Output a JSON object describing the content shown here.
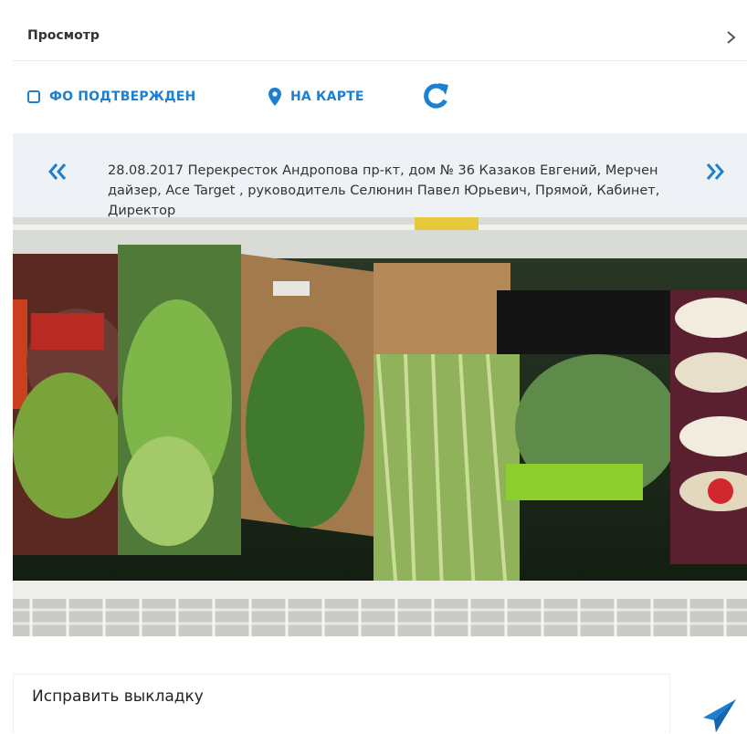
{
  "header": {
    "title": "Просмотр",
    "chevron_icon": "chevron-right-icon"
  },
  "toolbar": {
    "confirmed_label": "ФО ПОДТВЕРЖДЕН",
    "confirmed_checked": false,
    "map_label": "НА КАРТЕ",
    "map_icon": "map-pin-icon",
    "refresh_icon": "refresh-icon"
  },
  "record": {
    "prev_icon": "double-chevron-left-icon",
    "next_icon": "double-chevron-right-icon",
    "description": "28.08.2017 Перекресток Андропова пр-кт, дом № 36 Казаков Евгений, Мерчендайзер, Ace Target , руководитель Селюнин Павел Юрьевич, Прямой, Кабинет, Директор"
  },
  "photo": {
    "alt": "Фото выкладки зелени на полке"
  },
  "comment": {
    "value": "Исправить выкладку",
    "send_icon": "send-icon"
  },
  "colors": {
    "accent": "#1e7fd0",
    "info_bg": "#eef2f6",
    "border": "#e6e9ee"
  }
}
